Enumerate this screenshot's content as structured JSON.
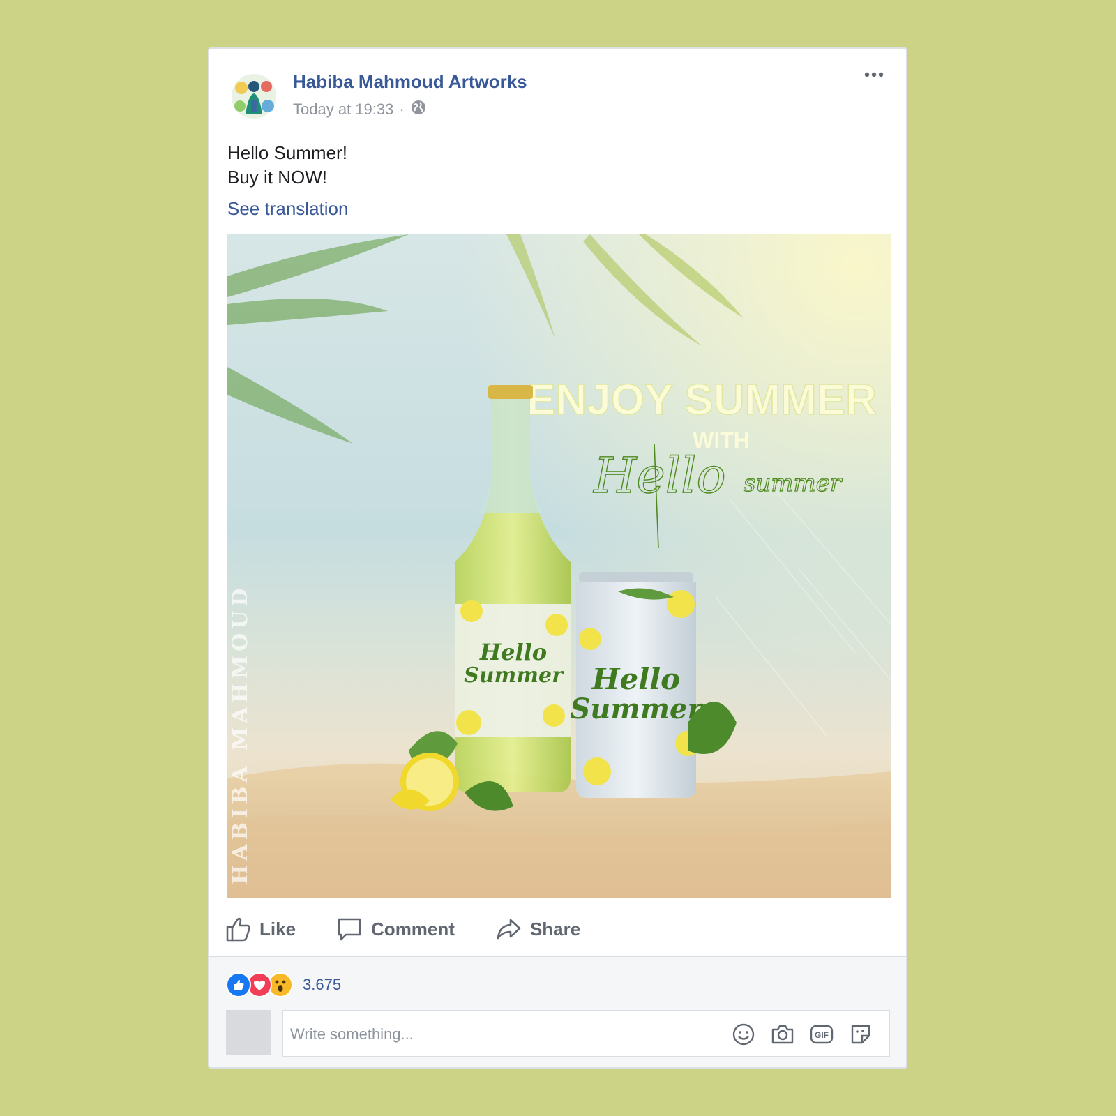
{
  "post": {
    "page_name": "Habiba Mahmoud Artworks",
    "timestamp": "Today at 19:33",
    "separator": "·",
    "audience_icon": "globe-icon",
    "text_lines": [
      "Hello Summer!",
      "Buy it NOW!"
    ],
    "see_translation": "See translation"
  },
  "image": {
    "headline": "ENJOY SUMMER",
    "with": "WITH",
    "script_hello": "Hello",
    "script_summer": "summer",
    "bottle_label_1": "Hello",
    "bottle_label_2": "Summer",
    "can_label_1": "Hello",
    "can_label_2": "Summer",
    "watermark": "HABIBA MAHMOUD"
  },
  "actions": {
    "like": "Like",
    "comment": "Comment",
    "share": "Share"
  },
  "footer": {
    "reaction_count": "3.675",
    "reaction_icons": [
      "like-reaction-icon",
      "love-reaction-icon",
      "wow-reaction-icon"
    ],
    "comment_placeholder": "Write something...",
    "comment_icons": [
      "emoji-icon",
      "camera-icon",
      "gif-icon",
      "sticker-icon"
    ]
  },
  "colors": {
    "background": "#ccd386",
    "link": "#385898",
    "meta": "#90949c",
    "action": "#606770",
    "like_blue": "#1877f2",
    "love_red": "#f33e58",
    "wow_yellow": "#f7b928",
    "script_green": "#4f8a1e"
  }
}
